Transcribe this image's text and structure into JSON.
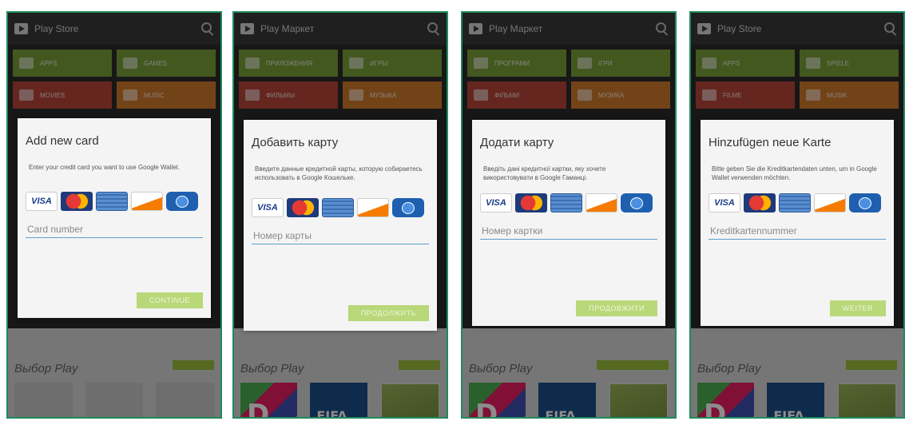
{
  "accent_color": "#9cc23b",
  "screens": [
    {
      "app_title": "Play Store",
      "tiles": [
        "APPS",
        "GAMES",
        "MOVIES",
        "MUSIC"
      ],
      "dialog_title": "Add new card",
      "dialog_message": "Enter your credit card you want to use Google Wallet.",
      "card_placeholder": "Card number",
      "continue_label": "CONTINUE",
      "picks_title": "Выбор Play"
    },
    {
      "app_title": "Play Маркет",
      "tiles": [
        "ПРИЛОЖЕНИЯ",
        "ИГРЫ",
        "ФИЛЬМЫ",
        "МУЗЫКА"
      ],
      "dialog_title": "Добавить карту",
      "dialog_message": "Введите данные кредитной карты, которую собираетесь использовать в Google Кошельке.",
      "card_placeholder": "Номер карты",
      "continue_label": "ПРОДОЛЖИТЬ",
      "picks_title": "Выбор Play"
    },
    {
      "app_title": "Play Маркет",
      "tiles": [
        "ПРОГРАМИ",
        "ІГРИ",
        "ФІЛЬМИ",
        "МУЗИКА"
      ],
      "dialog_title": "Додати карту",
      "dialog_message": "Введіть дані кредитної картки, яку хочете використовувати в Google Гаманці.",
      "card_placeholder": "Номер картки",
      "continue_label": "ПРОДОВЖИТИ",
      "picks_title": "Выбор Play"
    },
    {
      "app_title": "Play Store",
      "tiles": [
        "APPS",
        "SPIELE",
        "FILME",
        "MUSIK"
      ],
      "dialog_title": "Hinzufügen neue Karte",
      "dialog_message": "Bitte geben Sie die Kreditkartendaten unten, um in Google Wallet verwenden möchten.",
      "card_placeholder": "Kreditkartennummer",
      "continue_label": "WEITER",
      "picks_title": "Выбор Play"
    }
  ]
}
